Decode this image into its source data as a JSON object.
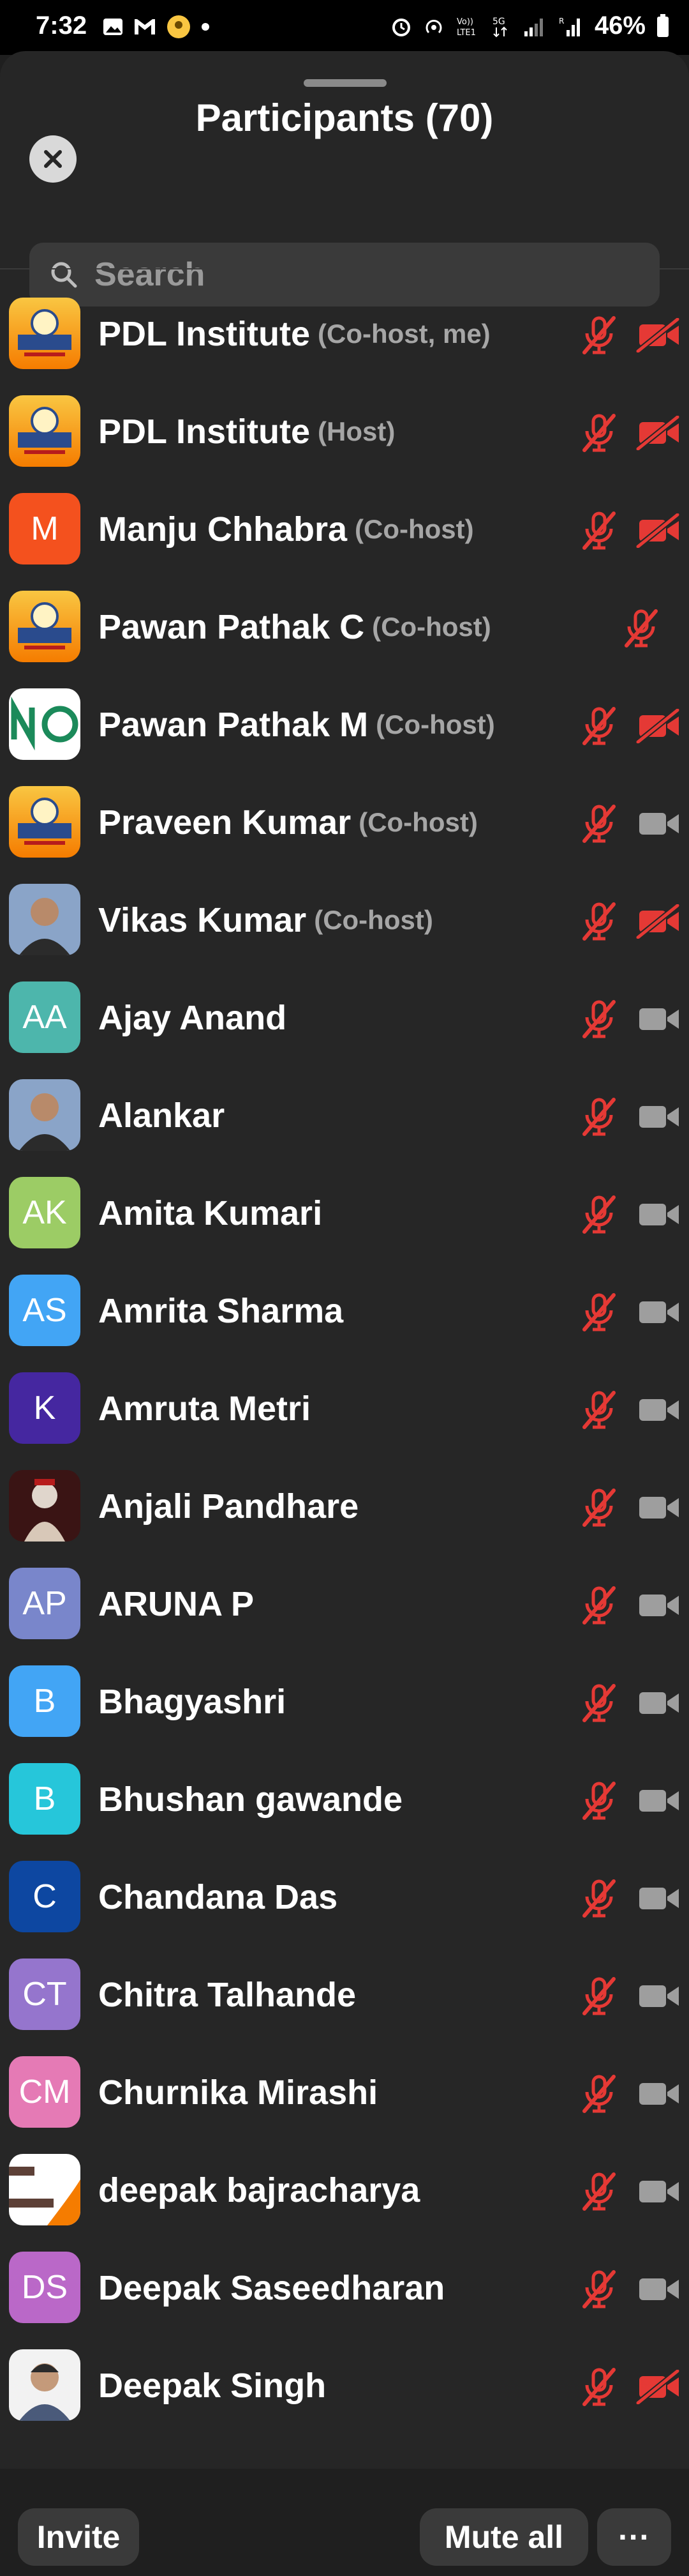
{
  "status_bar": {
    "time": "7:32",
    "battery": "46%"
  },
  "header": {
    "title": "Participants (70)"
  },
  "search": {
    "placeholder": "Search"
  },
  "participants": [
    {
      "name": "PDL Institute",
      "role": "(Co-host, me)",
      "avatar": {
        "type": "logo"
      },
      "mic": "muted",
      "cam": "off"
    },
    {
      "name": "PDL Institute",
      "role": "(Host)",
      "avatar": {
        "type": "logo"
      },
      "mic": "muted",
      "cam": "off"
    },
    {
      "name": "Manju Chhabra",
      "role": "(Co-host)",
      "avatar": {
        "type": "initials",
        "text": "M",
        "color": "#f4511e"
      },
      "mic": "muted",
      "cam": "off"
    },
    {
      "name": "Pawan Pathak C",
      "role": "(Co-host)",
      "avatar": {
        "type": "logo"
      },
      "mic": "muted",
      "cam": "none"
    },
    {
      "name": "Pawan Pathak M",
      "role": "(Co-host)",
      "avatar": {
        "type": "photo-green"
      },
      "mic": "muted",
      "cam": "off"
    },
    {
      "name": "Praveen Kumar",
      "role": "(Co-host)",
      "avatar": {
        "type": "logo"
      },
      "mic": "muted",
      "cam": "on"
    },
    {
      "name": "Vikas Kumar",
      "role": "(Co-host)",
      "avatar": {
        "type": "photo-person"
      },
      "mic": "muted",
      "cam": "off"
    },
    {
      "name": "Ajay Anand",
      "role": "",
      "avatar": {
        "type": "initials",
        "text": "AA",
        "color": "#4db6ac"
      },
      "mic": "muted",
      "cam": "on"
    },
    {
      "name": "Alankar",
      "role": "",
      "avatar": {
        "type": "photo-person"
      },
      "mic": "muted",
      "cam": "on"
    },
    {
      "name": "Amita Kumari",
      "role": "",
      "avatar": {
        "type": "initials",
        "text": "AK",
        "color": "#9ccc65"
      },
      "mic": "muted",
      "cam": "on"
    },
    {
      "name": "Amrita Sharma",
      "role": "",
      "avatar": {
        "type": "initials",
        "text": "AS",
        "color": "#42a5f5"
      },
      "mic": "muted",
      "cam": "on"
    },
    {
      "name": "Amruta Metri",
      "role": "",
      "avatar": {
        "type": "initials",
        "text": "K",
        "color": "#4527a0"
      },
      "mic": "muted",
      "cam": "on"
    },
    {
      "name": "Anjali Pandhare",
      "role": "",
      "avatar": {
        "type": "photo-deity"
      },
      "mic": "muted",
      "cam": "on"
    },
    {
      "name": "ARUNA P",
      "role": "",
      "avatar": {
        "type": "initials",
        "text": "AP",
        "color": "#7986cb"
      },
      "mic": "muted",
      "cam": "on"
    },
    {
      "name": "Bhagyashri",
      "role": "",
      "avatar": {
        "type": "initials",
        "text": "B",
        "color": "#42a5f5"
      },
      "mic": "muted",
      "cam": "on"
    },
    {
      "name": "Bhushan  gawande",
      "role": "",
      "avatar": {
        "type": "initials",
        "text": "B",
        "color": "#26c6da"
      },
      "mic": "muted",
      "cam": "on"
    },
    {
      "name": "Chandana Das",
      "role": "",
      "avatar": {
        "type": "initials",
        "text": "C",
        "color": "#0d47a1"
      },
      "mic": "muted",
      "cam": "on"
    },
    {
      "name": "Chitra Talhande",
      "role": "",
      "avatar": {
        "type": "initials",
        "text": "CT",
        "color": "#9575cd"
      },
      "mic": "muted",
      "cam": "on"
    },
    {
      "name": "Churnika Mirashi",
      "role": "",
      "avatar": {
        "type": "initials",
        "text": "CM",
        "color": "#e57ab5"
      },
      "mic": "muted",
      "cam": "on"
    },
    {
      "name": "deepak bajracharya",
      "role": "",
      "avatar": {
        "type": "photo-text"
      },
      "mic": "muted",
      "cam": "on"
    },
    {
      "name": "Deepak Saseedharan",
      "role": "",
      "avatar": {
        "type": "initials",
        "text": "DS",
        "color": "#ba68c8"
      },
      "mic": "muted",
      "cam": "on"
    },
    {
      "name": "Deepak Singh",
      "role": "",
      "avatar": {
        "type": "photo-person2"
      },
      "mic": "muted",
      "cam": "off"
    }
  ],
  "footer": {
    "invite": "Invite",
    "mute_all": "Mute all",
    "more": "···"
  },
  "colors": {
    "muted_red": "#e53935",
    "icon_grey": "#9e9e9e"
  }
}
